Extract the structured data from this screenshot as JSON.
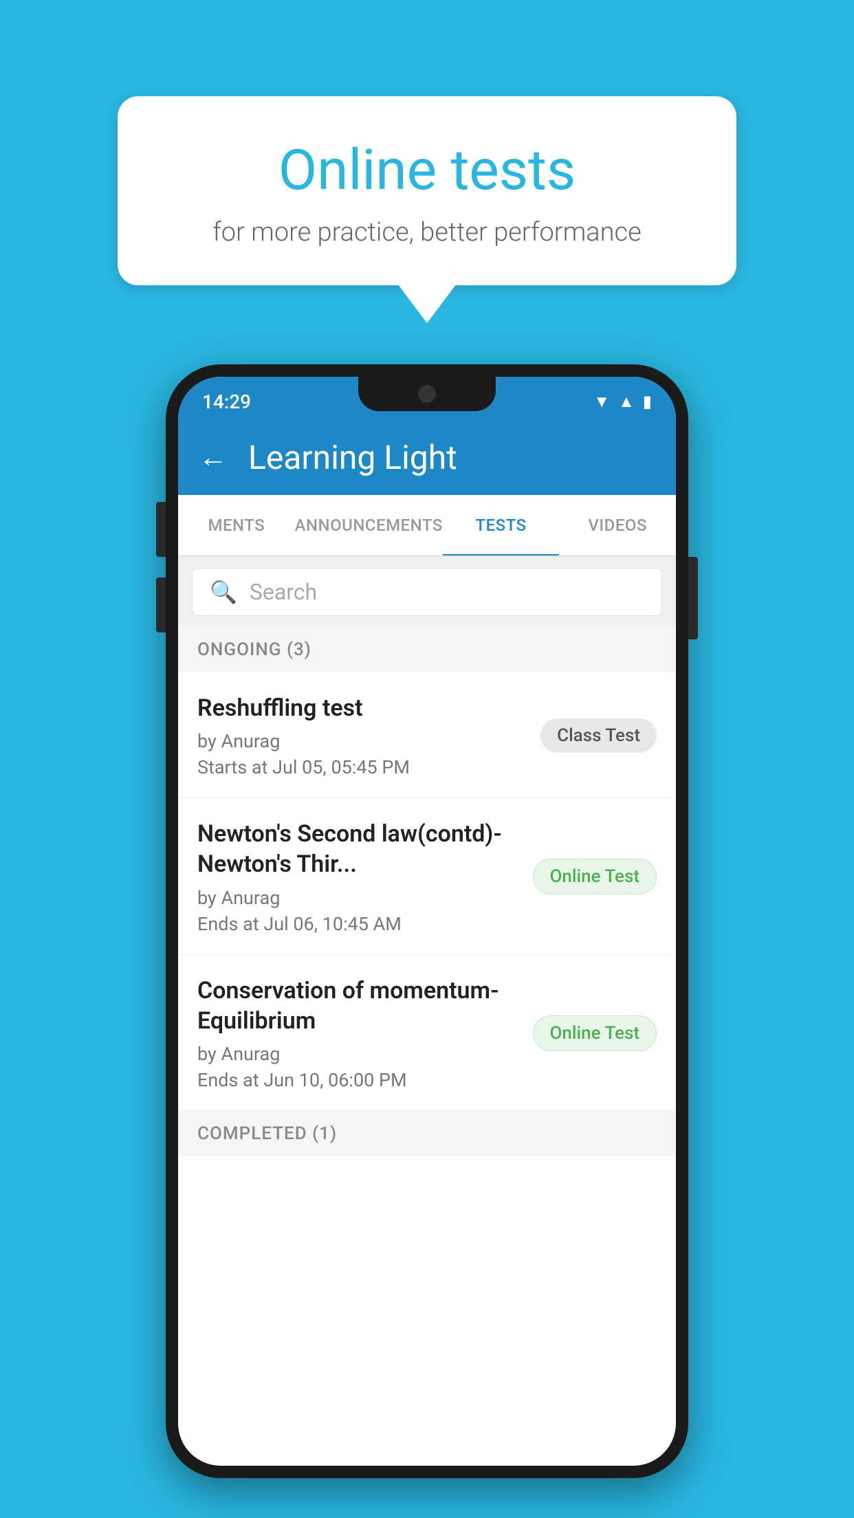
{
  "background_color": "#29b6e0",
  "speech_bubble": {
    "title": "Online tests",
    "subtitle": "for more practice, better performance"
  },
  "phone": {
    "status_bar": {
      "time": "14:29",
      "icons": [
        "wifi",
        "signal",
        "battery"
      ]
    },
    "app_bar": {
      "back_label": "←",
      "title": "Learning Light"
    },
    "tabs": [
      {
        "label": "MENTS",
        "active": false
      },
      {
        "label": "ANNOUNCEMENTS",
        "active": false
      },
      {
        "label": "TESTS",
        "active": true
      },
      {
        "label": "VIDEOS",
        "active": false
      }
    ],
    "search": {
      "placeholder": "Search"
    },
    "ongoing_section": {
      "label": "ONGOING (3)",
      "items": [
        {
          "title": "Reshuffling test",
          "by": "by Anurag",
          "date": "Starts at  Jul 05, 05:45 PM",
          "badge": "Class Test",
          "badge_type": "class"
        },
        {
          "title": "Newton's Second law(contd)-Newton's Thir...",
          "by": "by Anurag",
          "date": "Ends at  Jul 06, 10:45 AM",
          "badge": "Online Test",
          "badge_type": "online"
        },
        {
          "title": "Conservation of momentum-Equilibrium",
          "by": "by Anurag",
          "date": "Ends at  Jun 10, 06:00 PM",
          "badge": "Online Test",
          "badge_type": "online"
        }
      ]
    },
    "completed_section": {
      "label": "COMPLETED (1)"
    }
  }
}
